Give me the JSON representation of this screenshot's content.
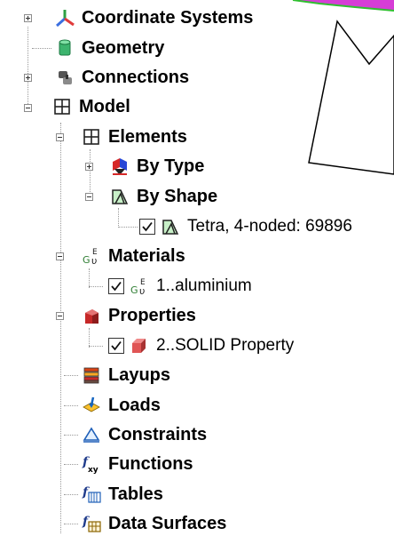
{
  "tree": {
    "coordinate_systems": "Coordinate Systems",
    "geometry": "Geometry",
    "connections": "Connections",
    "model": "Model",
    "elements": "Elements",
    "by_type": "By Type",
    "by_shape": "By Shape",
    "tetra": "Tetra, 4-noded: 69896",
    "materials": "Materials",
    "aluminium": "1..aluminium",
    "properties": "Properties",
    "solid_property": "2..SOLID Property",
    "layups": "Layups",
    "loads": "Loads",
    "constraints": "Constraints",
    "functions": "Functions",
    "tables": "Tables",
    "data_surfaces": "Data Surfaces"
  }
}
